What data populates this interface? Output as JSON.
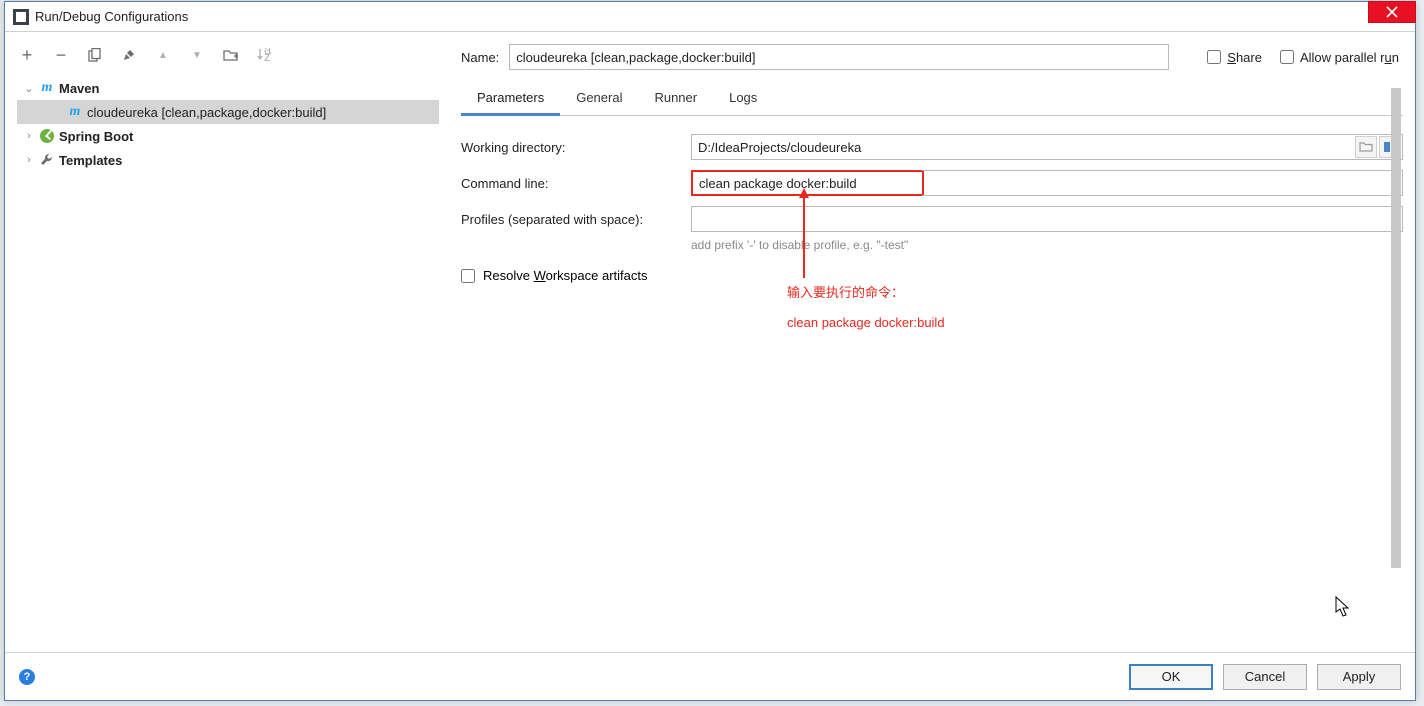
{
  "window": {
    "title": "Run/Debug Configurations"
  },
  "toolbar_icons": {
    "add": "+",
    "remove": "−",
    "copy": "⿻",
    "wrench": "🔧",
    "up": "▲",
    "down": "▼",
    "folder": "🗀",
    "sort": "↓ª"
  },
  "tree": {
    "maven": {
      "label": "Maven",
      "expanded": true
    },
    "maven_child": {
      "label": "cloudeureka [clean,package,docker:build]"
    },
    "spring": {
      "label": "Spring Boot",
      "expanded": false
    },
    "templates": {
      "label": "Templates",
      "expanded": false
    }
  },
  "form": {
    "name_label": "Name:",
    "name_value": "cloudeureka [clean,package,docker:build]",
    "share_label": "Share",
    "parallel_label": "Allow parallel run",
    "tabs": {
      "parameters": "Parameters",
      "general": "General",
      "runner": "Runner",
      "logs": "Logs"
    },
    "wd_label": "Working directory:",
    "wd_value": "D:/IdeaProjects/cloudeureka",
    "cmd_label": "Command line:",
    "cmd_value": "clean package docker:build",
    "profiles_label": "Profiles (separated with space):",
    "profiles_value": "",
    "profiles_hint": "add prefix '-' to disable profile, e.g. \"-test\"",
    "resolve_label": "Resolve Workspace artifacts"
  },
  "annotation": {
    "line1": "输入要执行的命令：",
    "line2": "clean package docker:build"
  },
  "footer": {
    "ok": "OK",
    "cancel": "Cancel",
    "apply": "Apply"
  }
}
